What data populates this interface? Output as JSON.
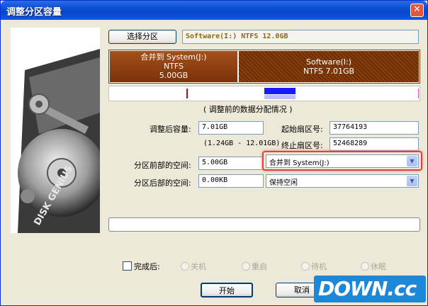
{
  "window": {
    "title": "调整分区容量",
    "close_symbol": "✕"
  },
  "select_partition": {
    "button_label": "选择分区",
    "info": "Software(I:) NTFS 12.0GB"
  },
  "partitions": [
    {
      "name": "合并到 System(J:)",
      "fs": "NTFS",
      "size": "5.00GB"
    },
    {
      "name": "Software(I:)",
      "fs": "NTFS 7.01GB"
    }
  ],
  "distribution_caption": "( 调整前的数据分配情况 )",
  "fields": {
    "size_after_label": "调整后容量:",
    "size_after_value": "7.01GB",
    "range_text": "(1.24GB - 12.01GB)",
    "start_sector_label": "起始扇区号:",
    "start_sector_value": "37764193",
    "end_sector_label": "终止扇区号:",
    "end_sector_value": "52468289",
    "space_before_label": "分区前部的空间:",
    "space_before_value": "5.00GB",
    "space_before_option": "合并到 System(J:)",
    "space_after_label": "分区后部的空间:",
    "space_after_value": "0.00KB",
    "space_after_option": "保持空闲"
  },
  "after_complete": {
    "label": "完成后:",
    "options": [
      "关机",
      "重启",
      "待机",
      "休眠"
    ]
  },
  "buttons": {
    "start": "开始",
    "cancel": "取消"
  },
  "branding": {
    "disk_label": "DISK GENIUS",
    "watermark": "DOWN.cc"
  },
  "colors": {
    "title_bar": "#0b4fd6",
    "partition_brown": "#8a3e0b",
    "highlight": "#e04040",
    "accent_blue": "#1a1aff"
  },
  "icons": [
    "close-icon",
    "chevron-down-icon",
    "hard-disk-image"
  ]
}
